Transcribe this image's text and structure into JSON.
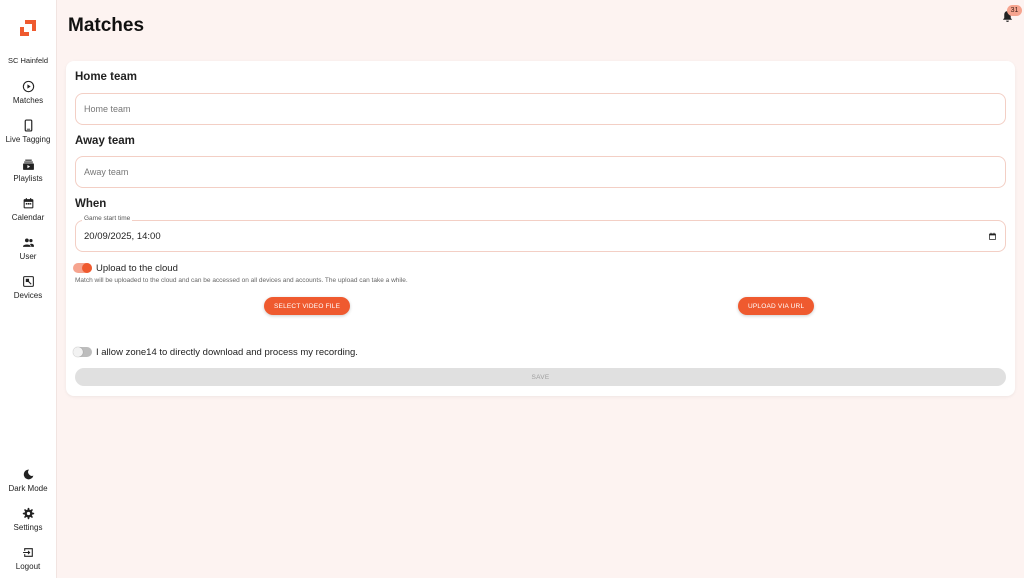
{
  "sidebar": {
    "club_name": "SC Hainfeld",
    "items": [
      {
        "label": "Matches",
        "icon": "play-circle-icon"
      },
      {
        "label": "Live Tagging",
        "icon": "smartphone-icon"
      },
      {
        "label": "Playlists",
        "icon": "playlist-icon"
      },
      {
        "label": "Calendar",
        "icon": "calendar-icon"
      },
      {
        "label": "User",
        "icon": "users-icon"
      },
      {
        "label": "Devices",
        "icon": "devices-icon"
      }
    ],
    "bottom_items": [
      {
        "label": "Dark Mode",
        "icon": "moon-icon"
      },
      {
        "label": "Settings",
        "icon": "gear-icon"
      },
      {
        "label": "Logout",
        "icon": "logout-icon"
      }
    ]
  },
  "header": {
    "title": "Matches",
    "notification_count": "31"
  },
  "form": {
    "home_team_label": "Home team",
    "home_team_placeholder": "Home team",
    "home_team_value": "",
    "away_team_label": "Away team",
    "away_team_placeholder": "Away team",
    "away_team_value": "",
    "when_label": "When",
    "game_start_legend": "Game start time",
    "game_start_value": "20/09/2025, 14:00",
    "upload_cloud_label": "Upload to the cloud",
    "upload_cloud_enabled": true,
    "upload_helper": "Match will be uploaded to the cloud and can be accessed on all devices and accounts. The upload can take a while.",
    "select_video_label": "SELECT VIDEO FILE",
    "upload_url_label": "UPLOAD VIA URL",
    "allow_download_label": "I allow zone14 to directly download and process my recording.",
    "allow_download_enabled": false,
    "save_label": "SAVE"
  },
  "colors": {
    "accent": "#ef5a2f",
    "accent_light": "#f6a48f",
    "background": "#fdf3f1",
    "input_border": "#f3cfc5"
  }
}
